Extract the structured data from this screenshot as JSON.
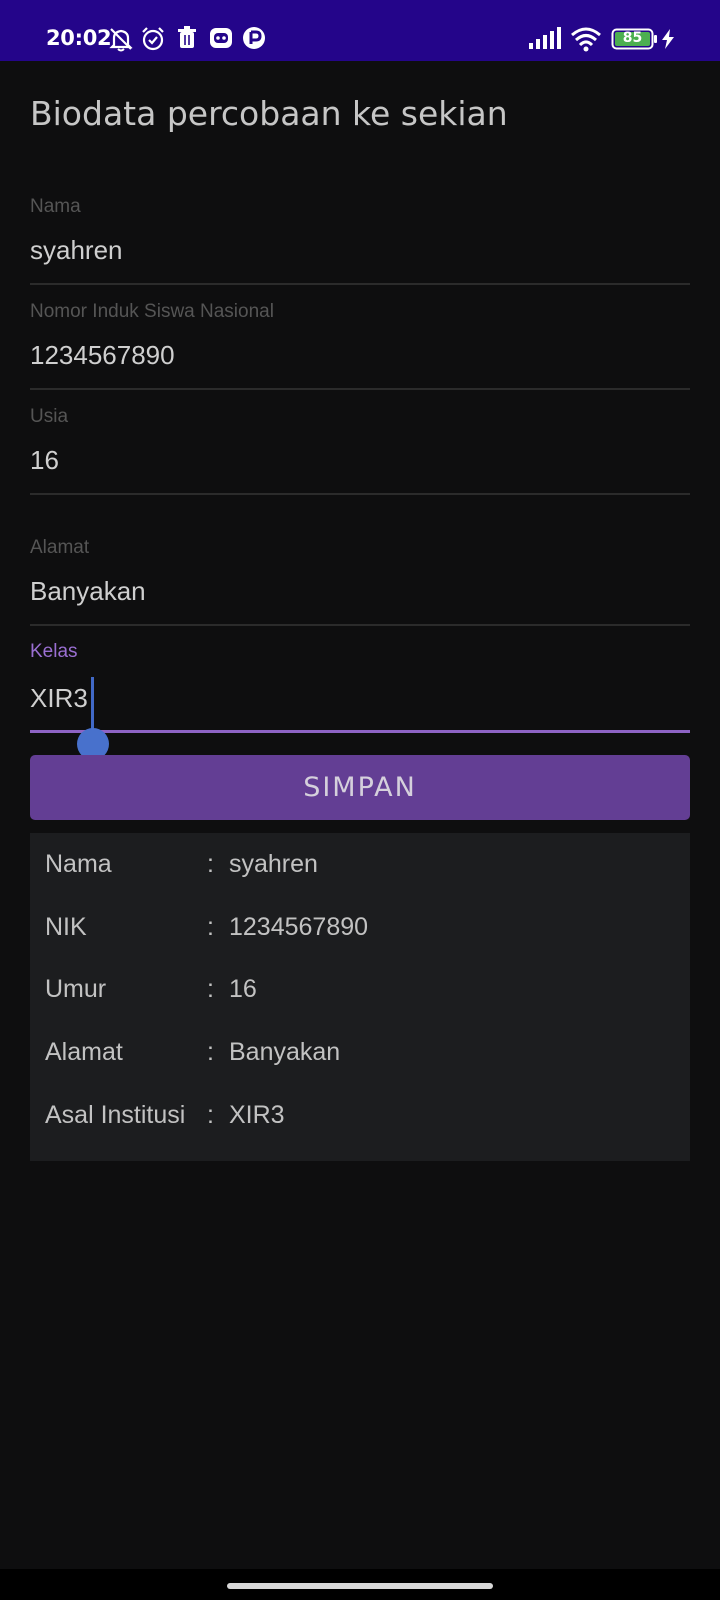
{
  "status_bar": {
    "time": "20:02",
    "left_icons": [
      "bell-off-icon",
      "alarm-icon",
      "trash-icon",
      "bot-app-icon",
      "media-app-icon"
    ],
    "right_icons": [
      "signal-icon",
      "wifi-icon",
      "battery-icon",
      "charging-icon"
    ],
    "battery_level": "85"
  },
  "page": {
    "title": "Biodata percobaan ke sekian"
  },
  "form": {
    "nama": {
      "label": "Nama",
      "value": "syahren"
    },
    "nisn": {
      "label": "Nomor Induk Siswa Nasional",
      "value": "1234567890"
    },
    "usia": {
      "label": "Usia",
      "value": "16"
    },
    "alamat": {
      "label": "Alamat",
      "value": "Banyakan"
    },
    "kelas": {
      "label": "Kelas",
      "value": "XIR3"
    }
  },
  "save_button": {
    "label": "SIMPAN"
  },
  "result": {
    "rows": [
      {
        "label": "Nama",
        "sep": ":",
        "value": "syahren"
      },
      {
        "label": "NIK",
        "sep": ":",
        "value": "1234567890"
      },
      {
        "label": "Umur",
        "sep": ":",
        "value": "16"
      },
      {
        "label": "Alamat",
        "sep": ":",
        "value": "Banyakan"
      },
      {
        "label": "Asal Institusi",
        "sep": ":",
        "value": "XIR3"
      }
    ]
  },
  "colors": {
    "status_bar_bg": "#24058a",
    "background": "#0e0e0f",
    "accent": "#8d63c4",
    "button_bg": "#633e94",
    "card_bg": "#1c1d1f",
    "cursor": "#4871cc"
  }
}
